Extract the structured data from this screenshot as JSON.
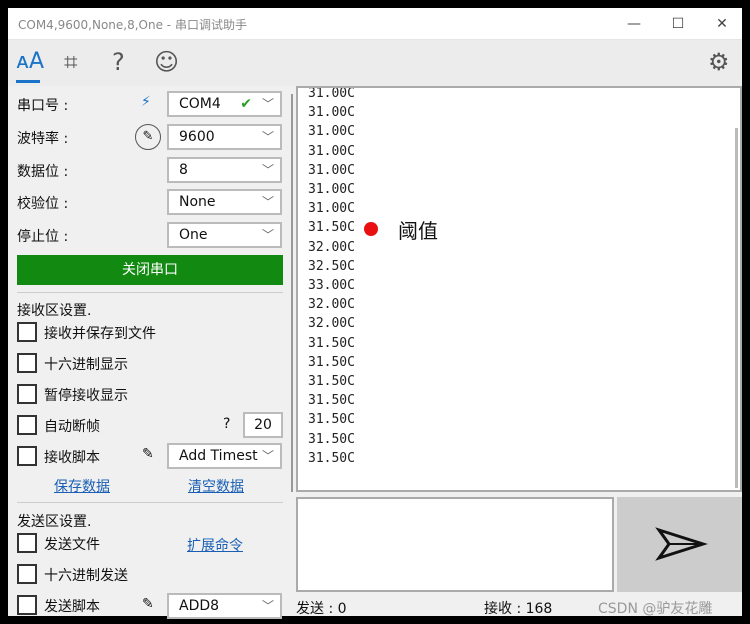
{
  "window": {
    "title": "COM4,9600,None,8,One - 串口调试助手"
  },
  "toolbar": {
    "icons": [
      "font-icon",
      "crop-icon",
      "help-icon",
      "smiley-icon",
      "gear-icon"
    ],
    "accent": "#1a73c8"
  },
  "serial": {
    "port_label": "串口号 :",
    "port_value": "COM4",
    "baud_label": "波特率 :",
    "baud_value": "9600",
    "databits_label": "数据位 :",
    "databits_value": "8",
    "parity_label": "校验位 :",
    "parity_value": "None",
    "stopbits_label": "停止位 :",
    "stopbits_value": "One",
    "close_button": "关闭串口",
    "close_button_color": "#128a12"
  },
  "receive_settings": {
    "title": "接收区设置.",
    "save_to_file": "接收并保存到文件",
    "hex_display": "十六进制显示",
    "pause_display": "暂停接收显示",
    "auto_frame": "自动断帧",
    "auto_frame_help": "?",
    "auto_frame_value": "20",
    "script": "接收脚本",
    "script_value": "Add Timest",
    "save_data": "保存数据",
    "clear_data": "清空数据"
  },
  "send_settings": {
    "title": "发送区设置.",
    "send_file": "发送文件",
    "expand_cmd": "扩展命令",
    "hex_send": "十六进制发送",
    "script": "发送脚本",
    "script_value": "ADD8"
  },
  "receive_lines": [
    "31.00C",
    "31.00C",
    "31.00C",
    "31.00C",
    "31.00C",
    "31.00C",
    "31.00C",
    "31.50C",
    "32.00C",
    "32.50C",
    "33.00C",
    "32.00C",
    "32.00C",
    "31.50C",
    "31.50C",
    "31.50C",
    "31.50C",
    "31.50C",
    "31.50C",
    "31.50C"
  ],
  "annotation": {
    "text": "阈值",
    "dot_color": "#e81010"
  },
  "status": {
    "sent": "发送 : 0",
    "received": "接收 : 168",
    "watermark": "CSDN @驴友花雕"
  }
}
